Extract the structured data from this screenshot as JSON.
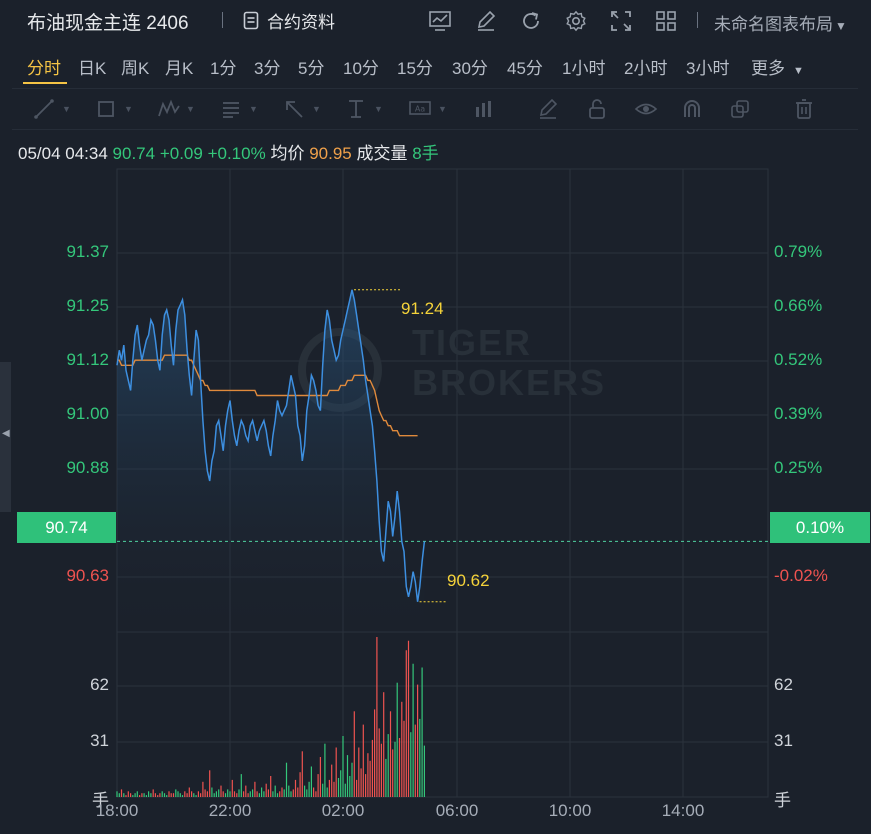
{
  "header": {
    "title": "布油现金主连 2406",
    "info_label": "合约资料",
    "layout_label": "未命名图表布局",
    "icons": [
      "chart-icon",
      "edit-icon",
      "refresh-icon",
      "settings-icon",
      "fullscreen-icon",
      "grid-layout-icon"
    ]
  },
  "periods": [
    "分时",
    "日K",
    "周K",
    "月K",
    "1分",
    "3分",
    "5分",
    "10分",
    "15分",
    "30分",
    "45分",
    "1小时",
    "2小时",
    "3小时",
    "更多"
  ],
  "active_period": "分时",
  "drawing_tools": [
    "line-tool-icon",
    "rect-tool-icon",
    "pattern-tool-icon",
    "fib-tool-icon",
    "arrow-tool-icon",
    "measure-tool-icon",
    "text-tool-icon",
    "bar-tool-icon",
    "brush-icon",
    "lock-icon",
    "eye-icon",
    "magnet-icon",
    "clone-icon",
    "trash-icon"
  ],
  "info": {
    "datetime": "05/04 04:34",
    "price": "90.74",
    "change": "+0.09",
    "change_pct": "+0.10%",
    "avg_label": "均价",
    "avg_value": "90.95",
    "volume_label": "成交量",
    "volume_value": "8手"
  },
  "watermark": [
    "TIGER",
    "BROKERS"
  ],
  "chart_data": {
    "type": "line",
    "price_axis_left": [
      "91.37",
      "91.25",
      "91.12",
      "91.00",
      "90.88",
      "90.63"
    ],
    "price_axis_right": [
      "0.79%",
      "0.66%",
      "0.52%",
      "0.39%",
      "0.25%",
      "-0.02%"
    ],
    "current_price_label": "90.74",
    "current_pct_label": "0.10%",
    "high_label": "91.24",
    "low_label": "90.62",
    "volume_axis_left": [
      "62",
      "31",
      "手"
    ],
    "volume_axis_right": [
      "62",
      "31",
      "手"
    ],
    "x_labels": [
      "18:00",
      "22:00",
      "02:00",
      "06:00",
      "10:00",
      "14:00"
    ],
    "prev_close": 90.65,
    "ylim": [
      90.56,
      91.48
    ],
    "volume_max": 84,
    "colors": {
      "up": "#34c77b",
      "down": "#ef5350",
      "price_line": "#3d8fe0",
      "avg_line": "#e08a3c",
      "highlight": "#f5d33a"
    },
    "series": [
      {
        "values": [
          91.09,
          91.12,
          91.1,
          91.13,
          91.08,
          91.06,
          91.04,
          91.1,
          91.15,
          91.17,
          91.13,
          91.1,
          91.12,
          91.14,
          91.15,
          91.18,
          91.17,
          91.14,
          91.1,
          91.08,
          91.15,
          91.19,
          91.2,
          91.18,
          91.13,
          91.09,
          91.16,
          91.2,
          91.21,
          91.22,
          91.19,
          91.12,
          91.07,
          91.03,
          91.1,
          91.16,
          91.14,
          91.06,
          90.98,
          90.92,
          90.88,
          90.86,
          90.9,
          90.92,
          90.97,
          90.98,
          90.95,
          90.92,
          90.97,
          91.0,
          91.02,
          90.98,
          90.95,
          90.93,
          90.96,
          90.98,
          90.97,
          90.95,
          90.94,
          90.97,
          90.98,
          90.96,
          90.94,
          90.96,
          90.97,
          90.98,
          90.96,
          90.93,
          90.91,
          90.95,
          90.98,
          91.02,
          91.0,
          90.99,
          91.0,
          91.01,
          91.04,
          91.07,
          91.05,
          91.03,
          90.97,
          90.95,
          90.9,
          90.93,
          91.0,
          91.03,
          91.07,
          91.06,
          91.04,
          91.01,
          91.0,
          91.09,
          91.16,
          91.2,
          91.18,
          91.14,
          91.12,
          91.1,
          91.11,
          91.14,
          91.16,
          91.18,
          91.2,
          91.22,
          91.24,
          91.22,
          91.19,
          91.16,
          91.13,
          91.1,
          91.06,
          91.03,
          91.0,
          90.97,
          90.92,
          90.86,
          90.78,
          90.72,
          90.7,
          90.76,
          90.82,
          90.8,
          90.75,
          90.79,
          90.84,
          90.8,
          90.74,
          90.72,
          90.65,
          90.63,
          90.65,
          90.68,
          90.66,
          90.62,
          90.65,
          90.7,
          90.74
        ]
      },
      {
        "values": [
          91.1,
          91.1,
          91.09,
          91.09,
          91.09,
          91.09,
          91.09,
          91.09,
          91.1,
          91.1,
          91.1,
          91.1,
          91.1,
          91.1,
          91.1,
          91.1,
          91.1,
          91.1,
          91.1,
          91.1,
          91.1,
          91.11,
          91.11,
          91.11,
          91.11,
          91.11,
          91.11,
          91.11,
          91.11,
          91.11,
          91.11,
          91.11,
          91.1,
          91.1,
          91.09,
          91.08,
          91.07,
          91.06,
          91.06,
          91.05,
          91.05,
          91.04,
          91.04,
          91.04,
          91.04,
          91.04,
          91.04,
          91.04,
          91.04,
          91.04,
          91.04,
          91.04,
          91.04,
          91.04,
          91.04,
          91.04,
          91.04,
          91.04,
          91.04,
          91.04,
          91.04,
          91.04,
          91.03,
          91.03,
          91.03,
          91.03,
          91.03,
          91.03,
          91.03,
          91.03,
          91.03,
          91.03,
          91.03,
          91.03,
          91.03,
          91.03,
          91.03,
          91.03,
          91.03,
          91.03,
          91.03,
          91.03,
          91.03,
          91.03,
          91.03,
          91.03,
          91.03,
          91.03,
          91.03,
          91.03,
          91.03,
          91.03,
          91.03,
          91.03,
          91.04,
          91.04,
          91.04,
          91.04,
          91.04,
          91.05,
          91.05,
          91.05,
          91.06,
          91.06,
          91.06,
          91.07,
          91.07,
          91.07,
          91.07,
          91.07,
          91.07,
          91.06,
          91.06,
          91.05,
          91.04,
          91.02,
          91.0,
          90.99,
          90.98,
          90.98,
          90.97,
          90.97,
          90.96,
          90.96,
          90.96,
          90.95,
          90.95,
          90.95,
          90.95,
          90.95,
          90.95,
          90.95,
          90.95,
          90.95
        ]
      },
      {
        "values": [
          3,
          2,
          4,
          2,
          1,
          3,
          2,
          1,
          2,
          3,
          1,
          2,
          2,
          1,
          3,
          2,
          4,
          2,
          1,
          2,
          3,
          2,
          1,
          3,
          2,
          2,
          4,
          3,
          2,
          1,
          3,
          2,
          5,
          3,
          2,
          1,
          3,
          2,
          8,
          4,
          3,
          14,
          5,
          2,
          3,
          4,
          6,
          3,
          2,
          4,
          3,
          9,
          3,
          2,
          4,
          12,
          3,
          6,
          2,
          3,
          4,
          8,
          3,
          2,
          5,
          3,
          7,
          4,
          11,
          3,
          6,
          2,
          3,
          5,
          4,
          18,
          6,
          3,
          4,
          9,
          5,
          13,
          24,
          6,
          4,
          8,
          16,
          5,
          3,
          12,
          21,
          7,
          28,
          5,
          9,
          17,
          8,
          26,
          10,
          14,
          32,
          7,
          22,
          11,
          18,
          45,
          9,
          26,
          15,
          38,
          12,
          23,
          19,
          30,
          46,
          84,
          36,
          28,
          55,
          20,
          33,
          45,
          25,
          29,
          60,
          31,
          50,
          40,
          77,
          82,
          34,
          70,
          38,
          59,
          41,
          68,
          27
        ]
      }
    ]
  }
}
